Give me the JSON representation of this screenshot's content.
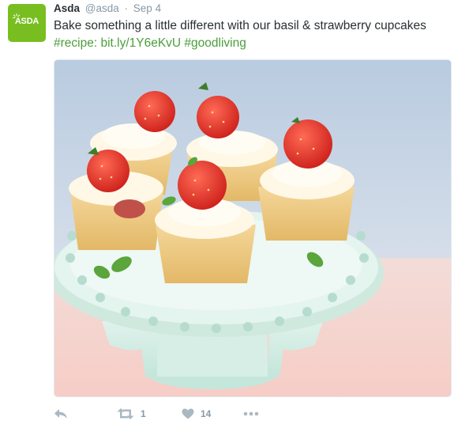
{
  "tweet": {
    "author_name": "Asda",
    "handle": "@asda",
    "separator": "·",
    "date": "Sep 4",
    "text": "Bake something a little different with our basil & strawberry cupcakes",
    "link": "#recipe: bit.ly/1Y6eKvU",
    "hashtag": "#goodliving",
    "avatar_text": "ASDA",
    "avatar_color": "#78be20",
    "link_color": "#4a9e3a"
  },
  "photo": {
    "subject": "basil and strawberry cupcakes on a cake stand"
  },
  "actions": {
    "reply_icon": "reply-icon",
    "retweet_icon": "retweet-icon",
    "retweet_count": "1",
    "like_icon": "heart-icon",
    "like_count": "14",
    "more_icon": "more-icon"
  }
}
